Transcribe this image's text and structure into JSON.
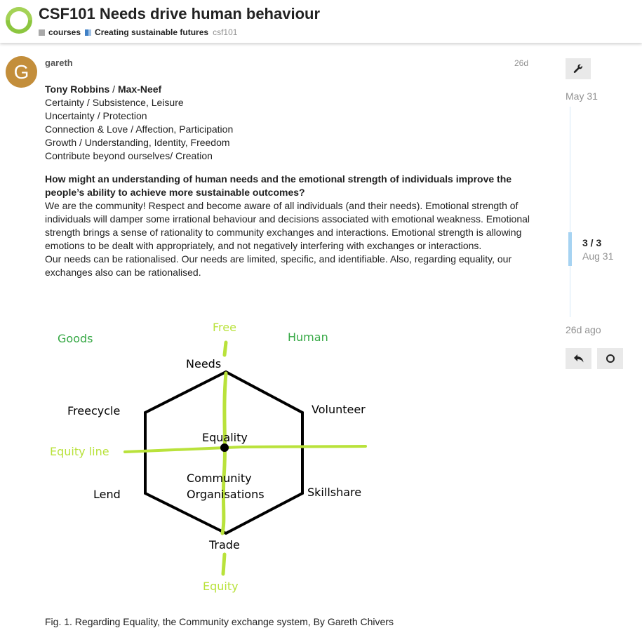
{
  "header": {
    "title": "CSF101 Needs drive human behaviour",
    "categories": [
      {
        "label": "courses",
        "color": "#a9a9a9"
      },
      {
        "label": "Creating sustainable futures",
        "color": "#3f80c6"
      }
    ],
    "tag": "csf101"
  },
  "post": {
    "avatar_letter": "G",
    "avatar_color": "#c38e3b",
    "username": "gareth",
    "date": "26d",
    "needs_heading": [
      "Tony Robbins",
      " / ",
      "Max-Neef"
    ],
    "needs_lines": [
      "Certainty / Subsistence, Leisure",
      "Uncertainty / Protection",
      "Connection & Love / Affection, Participation",
      "Growth / Understanding, Identity, Freedom",
      "Contribute beyond ourselves/ Creation"
    ],
    "question": "How might an understanding of human needs and the emotional strength of individuals improve the people’s ability to achieve more sustainable outcomes?",
    "paragraph1": "We are the community! Respect and become aware of all individuals (and their needs). Emotional strength of individuals will damper some irrational behaviour and decisions associated with emotional weakness. Emotional strength brings a sense of rationality to community exchanges and interactions. Emotional strength is allowing emotions to be dealt with appropriately, and not negatively interfering with exchanges or interactions.",
    "paragraph2": "Our needs can be rationalised. Our needs are limited, specific, and identifiable. Also, regarding equality, our exchanges also can be rationalised.",
    "figure": {
      "label_free": "Free",
      "label_goods": "Goods",
      "label_human": "Human",
      "label_needs": "Needs",
      "label_freecycle": "Freecycle",
      "label_volunteer": "Volunteer",
      "label_equality": "Equality",
      "label_equity_line": "Equity line",
      "label_community_1": "Community",
      "label_community_2": "Organisations",
      "label_lend": "Lend",
      "label_skillshare": "Skillshare",
      "label_trade": "Trade",
      "label_equity": "Equity",
      "green_color": "#35a844",
      "lime_color": "#b9e23b"
    },
    "caption": "Fig. 1. Regarding Equality, the Community exchange system, By Gareth Chivers"
  },
  "timeline": {
    "start_date": "May 31",
    "position": "3 / 3",
    "position_date": "Aug 31",
    "end_label": "26d ago"
  },
  "icons": {
    "admin": "wrench-icon",
    "reply": "reply-icon",
    "notify": "notification-circle-icon"
  }
}
